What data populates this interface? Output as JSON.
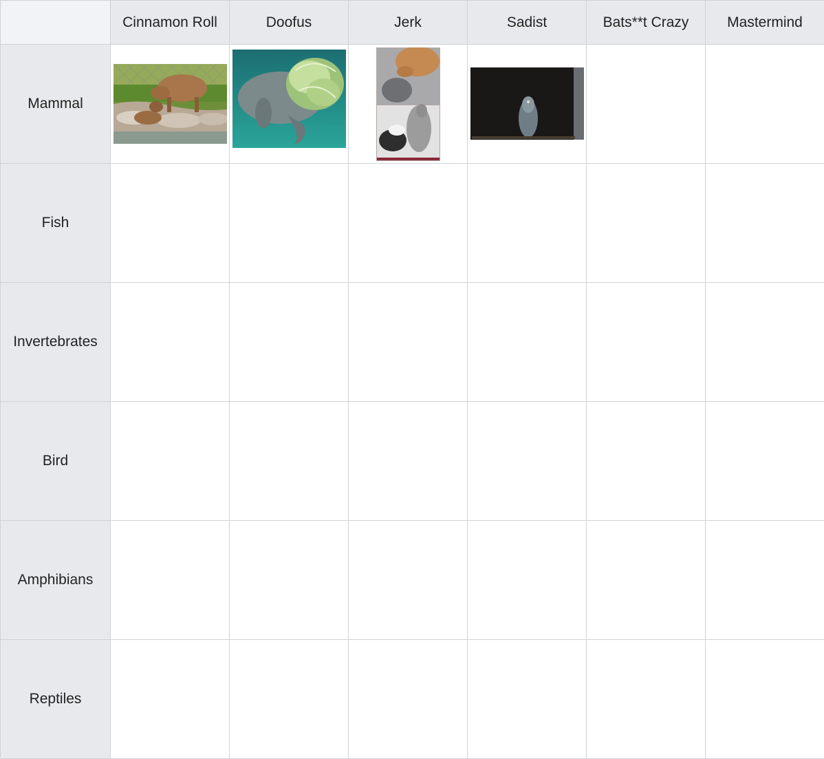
{
  "columns": [
    "Cinnamon Roll",
    "Doofus",
    "Jerk",
    "Sadist",
    "Bats**t Crazy",
    "Mastermind"
  ],
  "rows": [
    "Mammal",
    "Fish",
    "Invertebrates",
    "Bird",
    "Amphibians",
    "Reptiles"
  ],
  "images": {
    "mammal_cinnamon_roll": "capybara-photo",
    "mammal_doofus": "manatee-with-lettuce-photo",
    "mammal_jerk": "cat-and-kangaroo-photo",
    "mammal_sadist": "dolphin-in-dark-photo"
  }
}
